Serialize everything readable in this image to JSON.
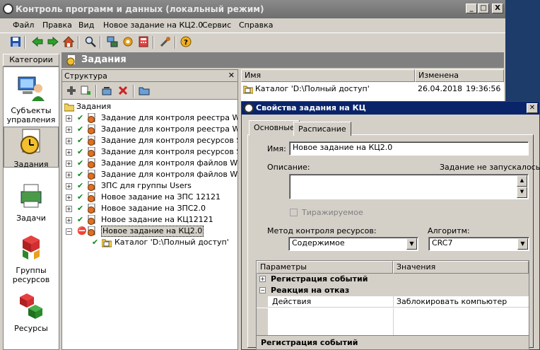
{
  "window": {
    "title": "Контроль программ и данных (локальный режим)",
    "min_glyph": "_",
    "max_glyph": "□",
    "close_glyph": "X"
  },
  "menu": [
    "Файл",
    "Правка",
    "Вид",
    "Новое задание на КЦ2.0",
    "Сервис",
    "Справка"
  ],
  "toolbar_icons": [
    "save-icon",
    "back-icon",
    "forward-icon",
    "home-icon",
    "search-icon",
    "network-icon",
    "gear-icon",
    "calculator-icon",
    "tools-icon",
    "help-icon"
  ],
  "categories": {
    "header": "Категории",
    "items": [
      {
        "label": "Субъекты управления",
        "icon": "user-computer-icon"
      },
      {
        "label": "Задания",
        "icon": "clock-document-icon"
      },
      {
        "label": "Задачи",
        "icon": "printer-icon"
      },
      {
        "label": "Группы ресурсов",
        "icon": "cubes-group-icon"
      },
      {
        "label": "Ресурсы",
        "icon": "cubes-icon"
      }
    ]
  },
  "tasks_header": "Задания",
  "structure": {
    "title": "Структура",
    "close_glyph": "✕",
    "tree_root": "Задания",
    "items": [
      {
        "label": "Задание для контроля реестра Windo",
        "expander": "+",
        "check": true,
        "selected": false
      },
      {
        "label": "Задание для контроля реестра Windo",
        "expander": "+",
        "check": true,
        "selected": false
      },
      {
        "label": "Задание для контроля ресурсов Secre",
        "expander": "+",
        "check": true,
        "selected": false
      },
      {
        "label": "Задание для контроля ресурсов Secre",
        "expander": "+",
        "check": true,
        "selected": false
      },
      {
        "label": "Задание для контроля файлов Window",
        "expander": "+",
        "check": true,
        "selected": false
      },
      {
        "label": "Задание для контроля файлов Window",
        "expander": "+",
        "check": true,
        "selected": false
      },
      {
        "label": "ЗПС для группы Users",
        "expander": "+",
        "check": true,
        "selected": false
      },
      {
        "label": "Новое задание на ЗПС 12121",
        "expander": "+",
        "check": true,
        "selected": false
      },
      {
        "label": "Новое задание на ЗПС2.0",
        "expander": "+",
        "check": true,
        "selected": false
      },
      {
        "label": "Новое задание на КЦ12121",
        "expander": "+",
        "check": true,
        "selected": false
      },
      {
        "label": "Новое задание на КЦ2.0",
        "expander": "−",
        "check": false,
        "selected": true
      }
    ],
    "child": "Каталог 'D:\\Полный доступ'"
  },
  "list": {
    "col_name": "Имя",
    "col_changed": "Изменена",
    "rows": [
      {
        "name": "Каталог 'D:\\Полный доступ'",
        "date": "26.04.2018",
        "time": "19:36:56"
      }
    ]
  },
  "dialog": {
    "title": "Свойства задания на КЦ",
    "close_glyph": "✕",
    "tabs": [
      "Основные",
      "Расписание"
    ],
    "name_label": "Имя:",
    "name_value": "Новое задание на КЦ2.0",
    "desc_label": "Описание:",
    "not_started": "Задание не запускалось",
    "replicated_label": "Тиражируемое",
    "method_label": "Метод контроля ресурсов:",
    "method_value": "Содержимое",
    "algo_label": "Алгоритм:",
    "algo_value": "CRC7",
    "grid": {
      "col_params": "Параметры",
      "col_values": "Значения",
      "group1": "Регистрация событий",
      "group2": "Реакция на отказ",
      "row_param": "Действия",
      "row_value": "Заблокировать компьютер",
      "footer": "Регистрация событий"
    }
  }
}
